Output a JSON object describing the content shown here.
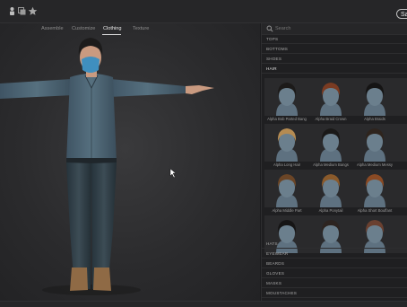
{
  "toolbar": {
    "save_label": "Sa",
    "icons": [
      "person-icon",
      "layers-icon",
      "star-icon"
    ]
  },
  "tabs": [
    {
      "label": "Assemble",
      "active": false
    },
    {
      "label": "Customize",
      "active": false
    },
    {
      "label": "Clothing",
      "active": true
    },
    {
      "label": "Texture",
      "active": false
    }
  ],
  "search": {
    "placeholder": "Search"
  },
  "categories_top": [
    "TOPS",
    "BOTTOMS",
    "SHOES",
    "HAIR"
  ],
  "hair_items": [
    {
      "label": "Alpha Bob Parted Bang",
      "color": "#1c1a19"
    },
    {
      "label": "Alpha Braid Crown",
      "color": "#7a3b22"
    },
    {
      "label": "Alpha Braids",
      "color": "#151414"
    },
    {
      "label": "Alpha",
      "color": "#161515"
    },
    {
      "label": "Alpha Long Hair",
      "color": "#b58b52"
    },
    {
      "label": "Alpha Medium Bangs",
      "color": "#1a1918"
    },
    {
      "label": "Alpha Medium Messy",
      "color": "#2e241d"
    },
    {
      "label": "Alpha M",
      "color": "#3a2a1f"
    },
    {
      "label": "Alpha Middle Part",
      "color": "#6b4526"
    },
    {
      "label": "Alpha Ponytail",
      "color": "#8a5a2b"
    },
    {
      "label": "Alpha Short Bouffant",
      "color": "#8a4a24"
    },
    {
      "label": "Alpha",
      "color": "#2a2320"
    },
    {
      "label": "",
      "color": "#161515"
    },
    {
      "label": "",
      "color": "#2d2420"
    },
    {
      "label": "",
      "color": "#6a4030"
    },
    {
      "label": "",
      "color": "#151414"
    }
  ],
  "categories_bottom": [
    "HATS",
    "EYEWEAR",
    "BEARDS",
    "GLOVES",
    "MASKS",
    "MOUSTACHES"
  ]
}
